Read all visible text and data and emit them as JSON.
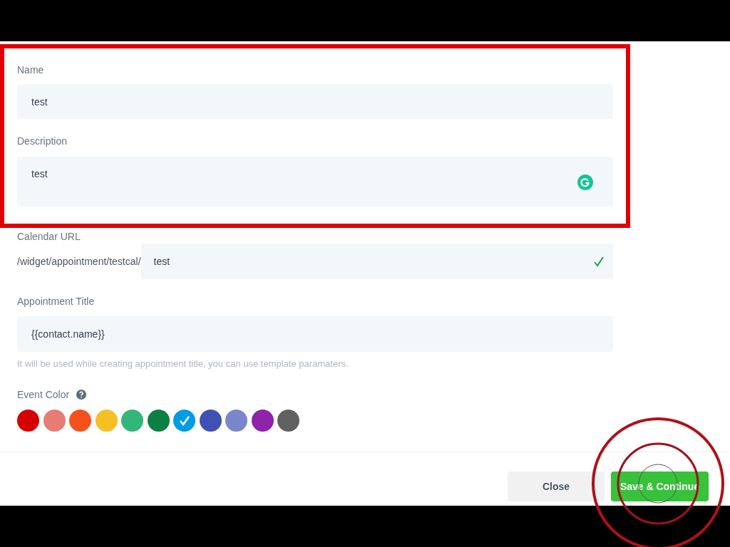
{
  "form": {
    "name": {
      "label": "Name",
      "value": "test"
    },
    "description": {
      "label": "Description",
      "value": "test"
    },
    "calendar_url": {
      "label": "Calendar URL",
      "prefix": "/widget/appointment/testcal/",
      "value": "test",
      "valid": true
    },
    "appointment_title": {
      "label": "Appointment Title",
      "value": "{{contact.name}}",
      "hint": "It will be used while creating appointment title, you can use template paramaters."
    },
    "event_color": {
      "label": "Event Color",
      "colors": [
        {
          "color": "#d50000",
          "selected": false
        },
        {
          "color": "#e67c73",
          "selected": false
        },
        {
          "color": "#f4511e",
          "selected": false
        },
        {
          "color": "#f6bf26",
          "selected": false
        },
        {
          "color": "#33b679",
          "selected": false
        },
        {
          "color": "#0b8043",
          "selected": false
        },
        {
          "color": "#039be5",
          "selected": true
        },
        {
          "color": "#3f51b5",
          "selected": false
        },
        {
          "color": "#7986cb",
          "selected": false
        },
        {
          "color": "#8e24aa",
          "selected": false
        },
        {
          "color": "#616161",
          "selected": false
        }
      ]
    }
  },
  "buttons": [
    {
      "label": "Close",
      "kind": "secondary"
    },
    {
      "label": "Save & Continue",
      "kind": "primary"
    }
  ]
}
